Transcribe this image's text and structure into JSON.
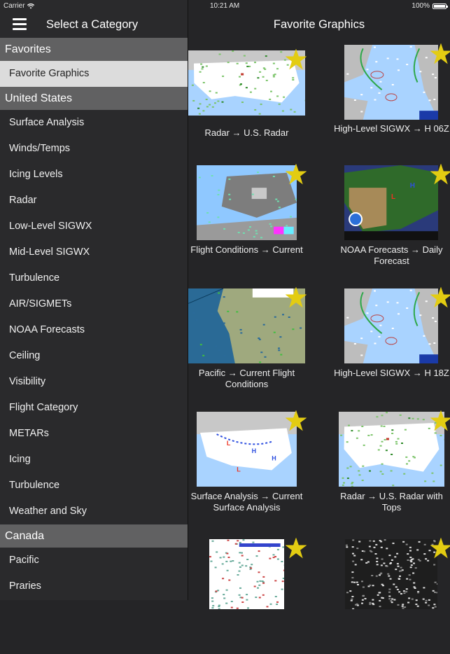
{
  "status_bar": {
    "carrier": "Carrier",
    "time": "10:21 AM",
    "battery": "100%",
    "battery_level_pct": 100
  },
  "left_nav": {
    "title": "Select a Category",
    "menu_icon": "hamburger-menu-icon"
  },
  "right_nav": {
    "title": "Favorite Graphics"
  },
  "sections": [
    {
      "header": "Favorites",
      "items": [
        {
          "label": "Favorite Graphics",
          "selected": true
        }
      ]
    },
    {
      "header": "United States",
      "items": [
        {
          "label": "Surface Analysis"
        },
        {
          "label": "Winds/Temps"
        },
        {
          "label": "Icing Levels"
        },
        {
          "label": "Radar"
        },
        {
          "label": "Low-Level SIGWX"
        },
        {
          "label": "Mid-Level SIGWX"
        },
        {
          "label": "Turbulence"
        },
        {
          "label": "AIR/SIGMETs"
        },
        {
          "label": "NOAA Forecasts"
        },
        {
          "label": "Ceiling"
        },
        {
          "label": "Visibility"
        },
        {
          "label": "Flight Category"
        },
        {
          "label": "METARs"
        },
        {
          "label": "Icing"
        },
        {
          "label": "Turbulence"
        },
        {
          "label": "Weather and Sky"
        }
      ]
    },
    {
      "header": "Canada",
      "items": [
        {
          "label": "Pacific"
        },
        {
          "label": "Praries"
        }
      ]
    }
  ],
  "favorites": [
    {
      "caption": "Radar → U.S. Radar",
      "thumb": "us-radar-map",
      "favorited": true
    },
    {
      "caption": "High-Level SIGWX → H 06Z",
      "thumb": "sigwx-map",
      "favorited": true
    },
    {
      "caption": "Flight Conditions → Current",
      "thumb": "europe-map",
      "favorited": true
    },
    {
      "caption": "NOAA Forecasts → Daily Forecast",
      "thumb": "noaa-forecast-map",
      "favorited": true
    },
    {
      "caption": "Pacific → Current Flight Conditions",
      "thumb": "pacific-map",
      "favorited": true
    },
    {
      "caption": "High-Level SIGWX → H 18Z",
      "thumb": "sigwx-map",
      "favorited": true
    },
    {
      "caption": "Surface Analysis → Current Surface Analysis",
      "thumb": "surface-analysis-map",
      "favorited": true
    },
    {
      "caption": "Radar → U.S. Radar with Tops",
      "thumb": "us-radar-tops-map",
      "favorited": true
    },
    {
      "caption": "",
      "thumb": "station-plot-map",
      "favorited": true
    },
    {
      "caption": "",
      "thumb": "satellite-map",
      "favorited": true
    }
  ],
  "colors": {
    "star": "#e3cc12",
    "section_header": "#616162",
    "selected_row": "#dcdcdc",
    "background": "#252527"
  }
}
